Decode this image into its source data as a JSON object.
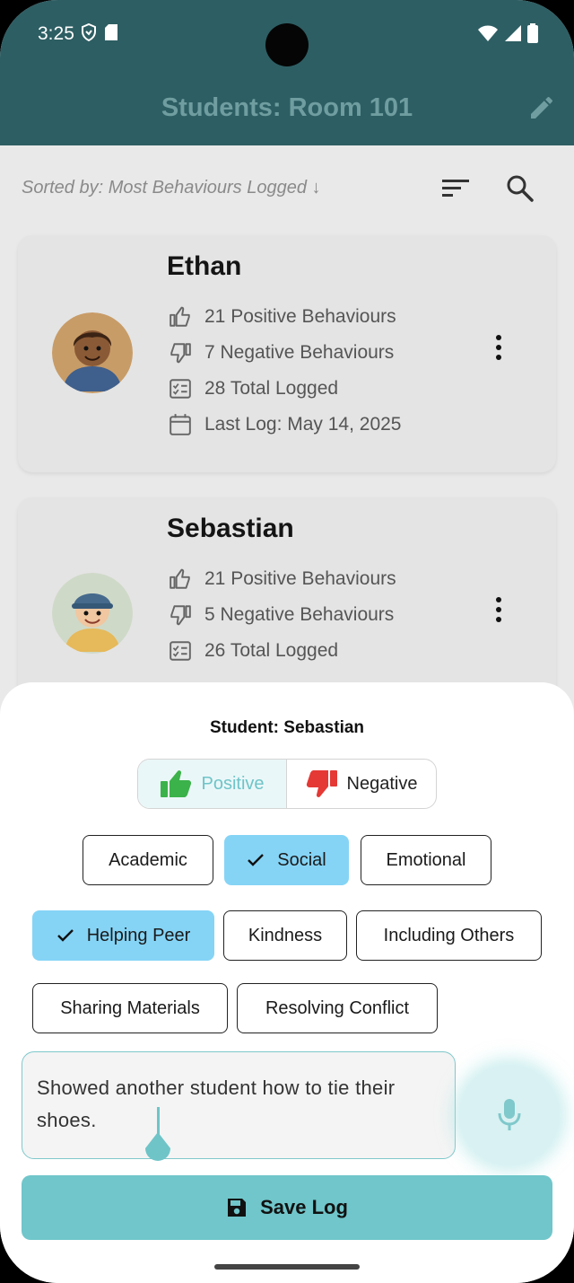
{
  "status_bar": {
    "time": "3:25"
  },
  "app_bar": {
    "title": "Students: Room 101"
  },
  "list": {
    "sort_label": "Sorted by: Most Behaviours Logged ↓",
    "students": [
      {
        "name": "Ethan",
        "positive": "21 Positive Behaviours",
        "negative": "7 Negative Behaviours",
        "total": "28 Total Logged",
        "last_log": "Last Log: May 14, 2025"
      },
      {
        "name": "Sebastian",
        "positive": "21 Positive Behaviours",
        "negative": "5 Negative Behaviours",
        "total": "26 Total Logged"
      }
    ]
  },
  "sheet": {
    "title": "Student: Sebastian",
    "segment": {
      "positive": "Positive",
      "negative": "Negative",
      "selected": "Positive"
    },
    "categories": [
      {
        "label": "Academic",
        "selected": false
      },
      {
        "label": "Social",
        "selected": true
      },
      {
        "label": "Emotional",
        "selected": false
      }
    ],
    "behaviours": [
      {
        "label": "Helping Peer",
        "selected": true
      },
      {
        "label": "Kindness",
        "selected": false
      },
      {
        "label": "Including Others",
        "selected": false
      },
      {
        "label": "Sharing Materials",
        "selected": false
      },
      {
        "label": "Resolving Conflict",
        "selected": false
      }
    ],
    "note_value": "Showed another student how to tie their shoes.",
    "save_label": "Save Log"
  },
  "colors": {
    "app_bar": "#2d5e63",
    "accent": "#70c6ca",
    "chip_selected": "#85d4f6",
    "thumb_up": "#3bb24a",
    "thumb_down": "#e53935"
  }
}
